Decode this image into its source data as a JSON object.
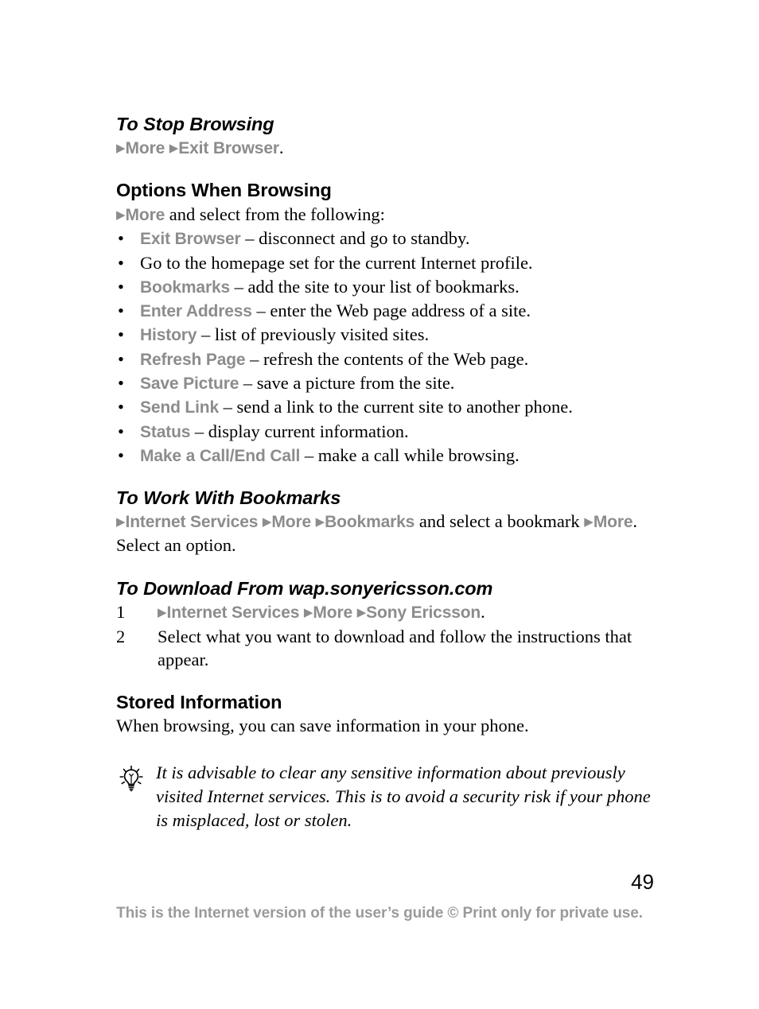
{
  "document": {
    "page_number": "49",
    "footer_note": "This is the Internet version of the user’s guide © Print only for private use."
  },
  "sections": {
    "stop_browsing": {
      "heading": "To Stop Browsing",
      "arrow": "▶",
      "step_more": "More",
      "step_exit": "Exit Browser",
      "step_period": "."
    },
    "options_when_browsing": {
      "heading": "Options When Browsing",
      "arrow": "▶",
      "intro_ui": "More",
      "intro_text": " and select from the following:",
      "bullet_char": "•",
      "items": [
        {
          "label": "Exit Browser",
          "desc": " – disconnect and go to standby."
        },
        {
          "label": "",
          "desc": "Go to the homepage set for the current Internet profile."
        },
        {
          "label": "Bookmarks",
          "desc": " – add the site to your list of bookmarks."
        },
        {
          "label": "Enter Address",
          "desc": " – enter the Web page address of a site."
        },
        {
          "label": "History",
          "desc": " – list of previously visited sites."
        },
        {
          "label": "Refresh Page",
          "desc": " – refresh the contents of the Web page."
        },
        {
          "label": "Save Picture",
          "desc": " – save a picture from the site."
        },
        {
          "label": "Send Link",
          "desc": " – send a link to the current site to another phone."
        },
        {
          "label": "Status",
          "desc": " – display current information."
        },
        {
          "label": "Make a Call/End Call",
          "desc": " – make a call while browsing."
        }
      ]
    },
    "work_with_bookmarks": {
      "heading": "To Work With Bookmarks",
      "arrow": "▶",
      "ui_internet_services": "Internet Services",
      "ui_more_1": "More",
      "ui_bookmarks": "Bookmarks",
      "text_middle": " and select a bookmark ",
      "ui_more_2": "More",
      "text_end": ". Select an option."
    },
    "download": {
      "heading": "To Download From wap.sonyericsson.com",
      "arrow": "▶",
      "steps": [
        {
          "number": "1",
          "ui_internet_services": "Internet Services",
          "ui_more": "More",
          "ui_sony_ericsson": "Sony Ericsson",
          "text_end": "."
        },
        {
          "number": "2",
          "text": "Select what you want to download and follow the instructions that appear."
        }
      ]
    },
    "stored_information": {
      "heading": "Stored Information",
      "body": "When browsing, you can save information in your phone.",
      "tip_icon_name": "lightbulb-tip-icon",
      "tip_text": "It is advisable to clear any sensitive information about previously visited Internet services. This is to avoid a security risk if your phone is misplaced, lost or stolen."
    }
  },
  "colors": {
    "ui_label_gray": "#8c8c8c",
    "footer_gray": "#9a9a9a",
    "text_black": "#000000",
    "page_background": "#ffffff"
  }
}
